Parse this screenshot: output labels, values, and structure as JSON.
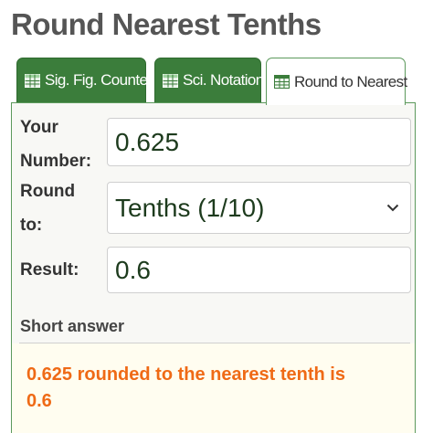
{
  "page": {
    "title": "Round Nearest Tenths"
  },
  "tabs": [
    {
      "label": "Sig. Fig. Counter",
      "icon": "table-icon",
      "active": false
    },
    {
      "label": "Sci. Notation",
      "icon": "table-icon",
      "active": false
    },
    {
      "label": "Round to Nearest",
      "icon": "table-icon",
      "active": true
    }
  ],
  "form": {
    "number_label_line1": "Your",
    "number_label_line2": "Number:",
    "number_value": "0.625",
    "round_label_line1": "Round",
    "round_label_line2": "to:",
    "round_selected": "Tenths (1/10)",
    "result_label": "Result:",
    "result_value": "0.6"
  },
  "short_answer": {
    "heading": "Short answer",
    "text_line1": "0.625 rounded to the nearest tenth is",
    "text_line2": "0.6"
  },
  "colors": {
    "tab_green": "#3b7d3b",
    "answer_orange": "#ef6a16",
    "title_gray": "#555555"
  }
}
